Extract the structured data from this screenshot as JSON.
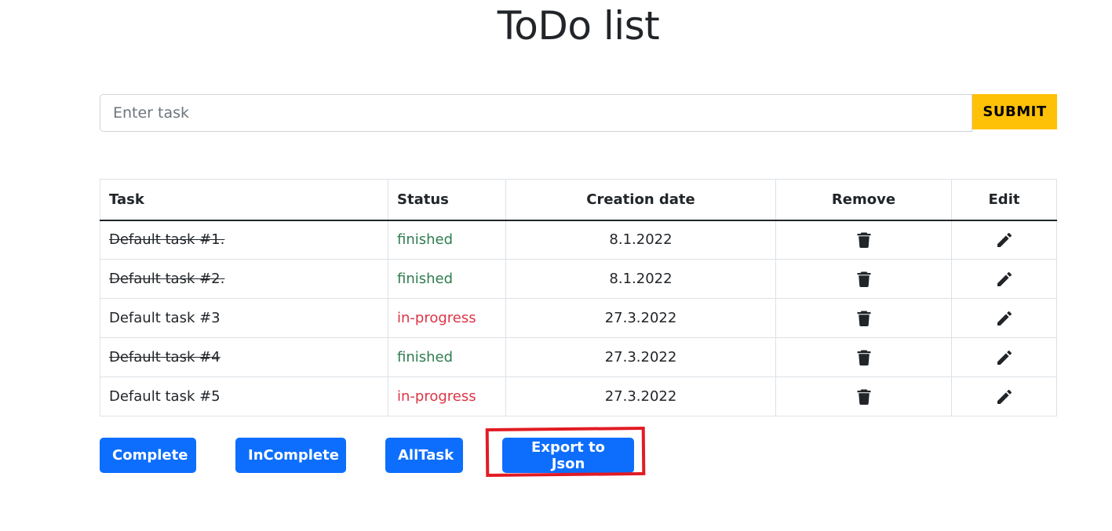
{
  "title": "ToDo list",
  "form": {
    "placeholder": "Enter task",
    "submit_label": "SUBMIT"
  },
  "table": {
    "headers": {
      "task": "Task",
      "status": "Status",
      "date": "Creation date",
      "remove": "Remove",
      "edit": "Edit"
    },
    "rows": [
      {
        "task": "Default task #1.",
        "status": "finished",
        "date": "8.1.2022"
      },
      {
        "task": "Default task #2.",
        "status": "finished",
        "date": "8.1.2022"
      },
      {
        "task": "Default task #3",
        "status": "in-progress",
        "date": "27.3.2022"
      },
      {
        "task": "Default task #4",
        "status": "finished",
        "date": "27.3.2022"
      },
      {
        "task": "Default task #5",
        "status": "in-progress",
        "date": "27.3.2022"
      }
    ],
    "remove_icon": "trash-icon",
    "edit_icon": "pencil-icon"
  },
  "filters": {
    "complete_label": "Complete",
    "incomplete_label": "InComplete",
    "alltask_label": "AllTask",
    "export_label": "Export to Json"
  },
  "colors": {
    "primary": "#0d6efd",
    "warning": "#ffc107",
    "finished": "#2e7d4f",
    "in_progress": "#dc3545",
    "annotation": "#e21b23"
  }
}
